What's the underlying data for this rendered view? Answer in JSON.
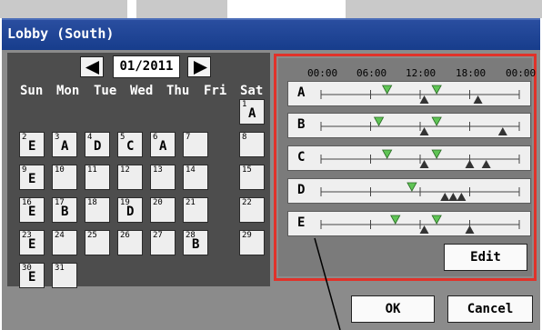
{
  "window": {
    "title": "Lobby (South)"
  },
  "calendar": {
    "month": "01/2011",
    "weekdays": [
      "Sun",
      "Mon",
      "Tue",
      "Wed",
      "Thu",
      "Fri",
      "Sat"
    ],
    "days": [
      {
        "n": "1",
        "p": "A"
      },
      {
        "n": "2",
        "p": "E"
      },
      {
        "n": "3",
        "p": "A"
      },
      {
        "n": "4",
        "p": "D"
      },
      {
        "n": "5",
        "p": "C"
      },
      {
        "n": "6",
        "p": "A"
      },
      {
        "n": "7",
        "p": ""
      },
      {
        "n": "8",
        "p": ""
      },
      {
        "n": "9",
        "p": "E"
      },
      {
        "n": "10",
        "p": ""
      },
      {
        "n": "11",
        "p": ""
      },
      {
        "n": "12",
        "p": ""
      },
      {
        "n": "13",
        "p": ""
      },
      {
        "n": "14",
        "p": ""
      },
      {
        "n": "15",
        "p": ""
      },
      {
        "n": "16",
        "p": "E"
      },
      {
        "n": "17",
        "p": "B"
      },
      {
        "n": "18",
        "p": ""
      },
      {
        "n": "19",
        "p": "D"
      },
      {
        "n": "20",
        "p": ""
      },
      {
        "n": "21",
        "p": ""
      },
      {
        "n": "22",
        "p": ""
      },
      {
        "n": "23",
        "p": "E"
      },
      {
        "n": "24",
        "p": ""
      },
      {
        "n": "25",
        "p": ""
      },
      {
        "n": "26",
        "p": ""
      },
      {
        "n": "27",
        "p": ""
      },
      {
        "n": "28",
        "p": "B"
      },
      {
        "n": "29",
        "p": ""
      },
      {
        "n": "30",
        "p": "E"
      },
      {
        "n": "31",
        "p": ""
      }
    ]
  },
  "schedule": {
    "time_labels": [
      "00:00",
      "06:00",
      "12:00",
      "18:00",
      "00:00"
    ],
    "patterns": [
      {
        "label": "A",
        "on_hours": [
          8,
          14
        ],
        "off_hours": [
          12.5,
          19
        ]
      },
      {
        "label": "B",
        "on_hours": [
          7,
          14
        ],
        "off_hours": [
          12.5,
          22
        ]
      },
      {
        "label": "C",
        "on_hours": [
          8,
          14
        ],
        "off_hours": [
          12.5,
          18,
          20
        ]
      },
      {
        "label": "D",
        "on_hours": [
          11
        ],
        "off_hours": [
          15,
          16,
          17
        ]
      },
      {
        "label": "E",
        "on_hours": [
          9,
          14
        ],
        "off_hours": [
          12.5,
          18
        ]
      }
    ],
    "edit_label": "Edit"
  },
  "footer": {
    "ok_label": "OK",
    "cancel_label": "Cancel"
  },
  "colors": {
    "title_bar": "#1c428f",
    "highlight_frame": "#e0322a",
    "on_marker": "#5fc455",
    "off_marker": "#333333"
  }
}
